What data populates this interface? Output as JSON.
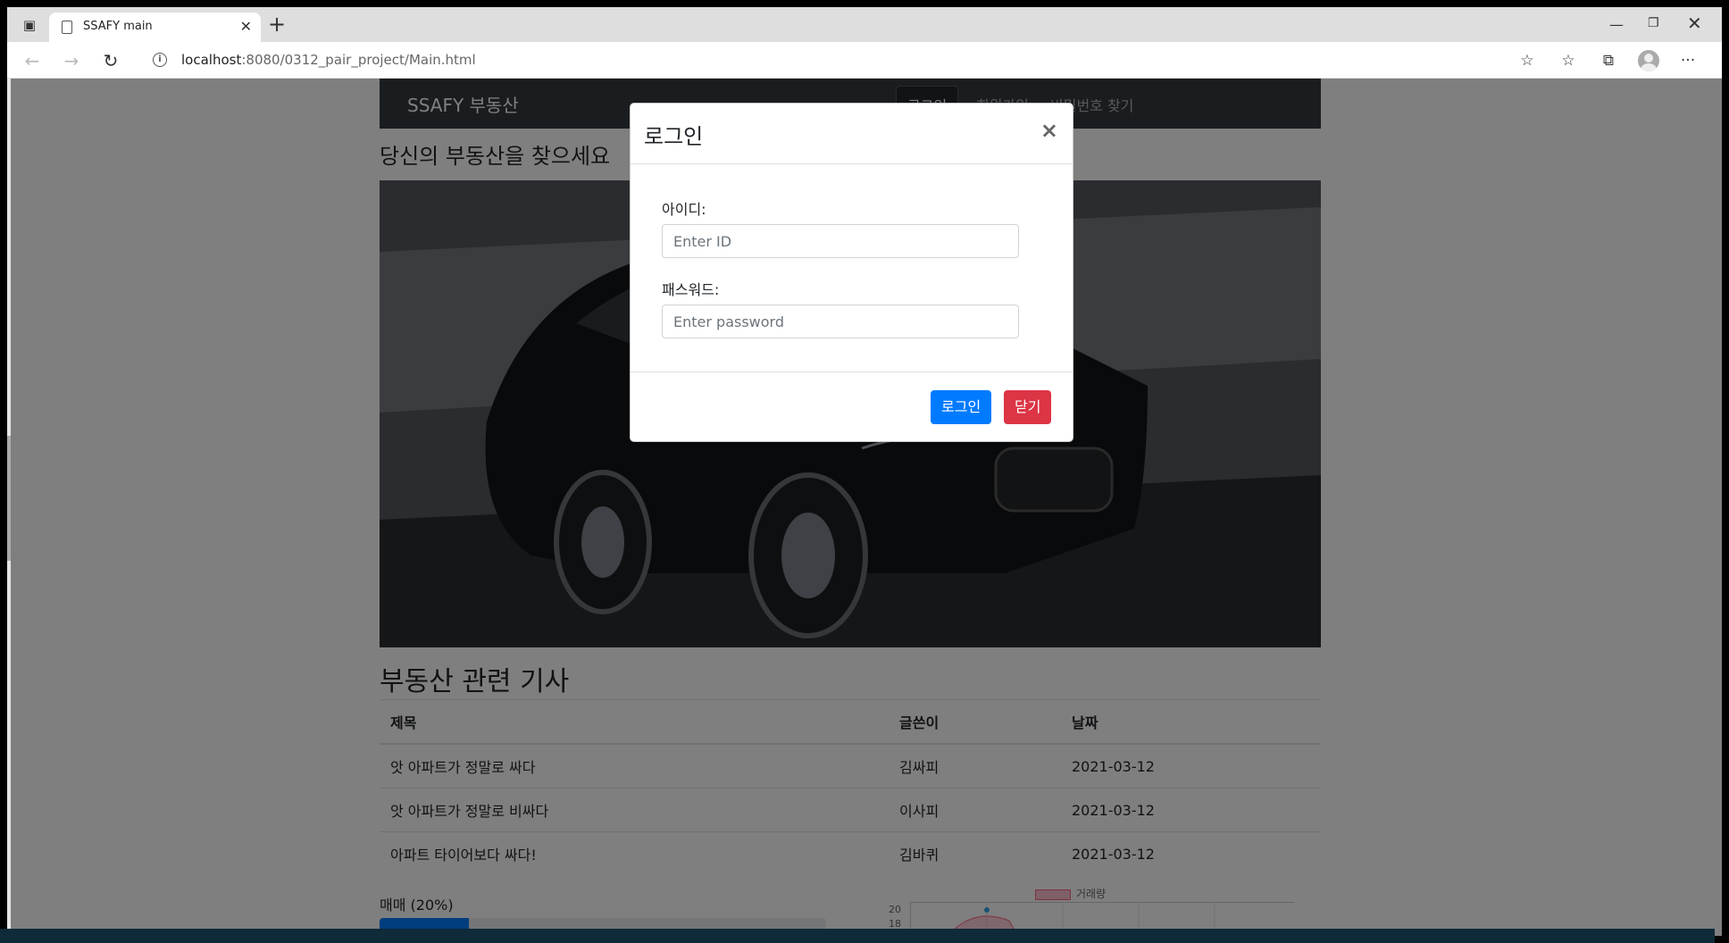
{
  "browser": {
    "tab_title": "SSAFY main",
    "new_tab_label": "+",
    "url_host": "localhost",
    "url_path": ":8080/0312_pair_project/Main.html",
    "back_icon": "←",
    "forward_icon": "→",
    "refresh_icon": "↻",
    "favorite_add_icon": "☆",
    "favorites_icon": "☆",
    "collections_icon": "⧉",
    "more_icon": "···",
    "minimize_icon": "—",
    "restore_icon": "❐",
    "close_icon": "✕",
    "tab_close_icon": "✕"
  },
  "navbar": {
    "brand": "SSAFY 부동산",
    "items": [
      "로그인",
      "회원가입",
      "비밀번호 찾기"
    ]
  },
  "hero": {
    "title": "당신의 부동산을 찾으세요"
  },
  "news": {
    "title": "부동산 관련 기사",
    "headers": [
      "제목",
      "글쓴이",
      "날짜"
    ],
    "rows": [
      [
        "앗 아파트가 정말로 싸다",
        "김싸피",
        "2021-03-12"
      ],
      [
        "앗 아파트가 정말로 비싸다",
        "이사피",
        "2021-03-12"
      ],
      [
        "아파트 타이어보다 싸다!",
        "김바퀴",
        "2021-03-12"
      ]
    ]
  },
  "progress": {
    "label": "매매 (20%)",
    "percent": 20
  },
  "mini_chart": {
    "legend": "거래량",
    "ticks": [
      "20",
      "18"
    ]
  },
  "modal": {
    "title": "로그인",
    "close_icon": "×",
    "id_label": "아이디:",
    "id_placeholder": "Enter ID",
    "pw_label": "패스워드:",
    "pw_placeholder": "Enter password",
    "login_button": "로그인",
    "close_button": "닫기"
  },
  "colors": {
    "navbar": "#343a40",
    "primary": "#007bff",
    "danger": "#dc3545"
  }
}
